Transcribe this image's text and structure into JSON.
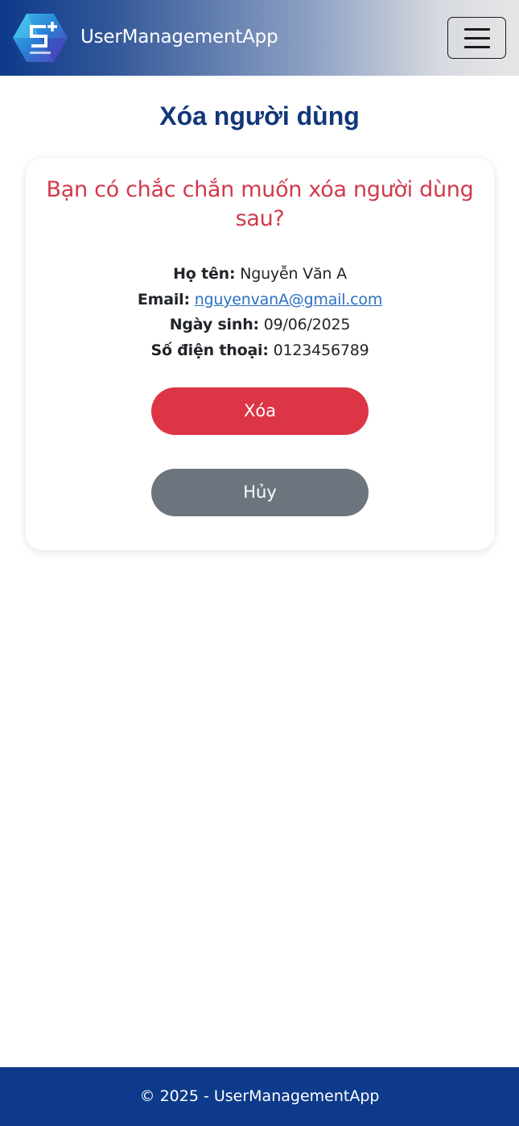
{
  "navbar": {
    "brand": "UserManagementApp",
    "logo_icon": "hexagon-s-plus-logo",
    "menu_icon": "hamburger-menu-icon",
    "gradient_start": "#0d3a8a",
    "gradient_end": "#e6e6e6"
  },
  "page": {
    "title": "Xóa người dùng"
  },
  "confirm": {
    "question": "Bạn có chắc chắn muốn xóa người dùng sau?",
    "question_color": "#d03a4b",
    "fields": {
      "name_label": "Họ tên:",
      "name_value": "Nguyễn Văn A",
      "email_label": "Email:",
      "email_value": "nguyenvanA@gmail.com",
      "dob_label": "Ngày sinh:",
      "dob_value": "09/06/2025",
      "phone_label": "Số điện thoại:",
      "phone_value": "0123456789"
    },
    "delete_label": "Xóa",
    "delete_color": "#dc3545",
    "cancel_label": "Hủy",
    "cancel_color": "#6c757d"
  },
  "footer": {
    "text": "© 2025 - UserManagementApp",
    "color": "#0d3a8a"
  }
}
